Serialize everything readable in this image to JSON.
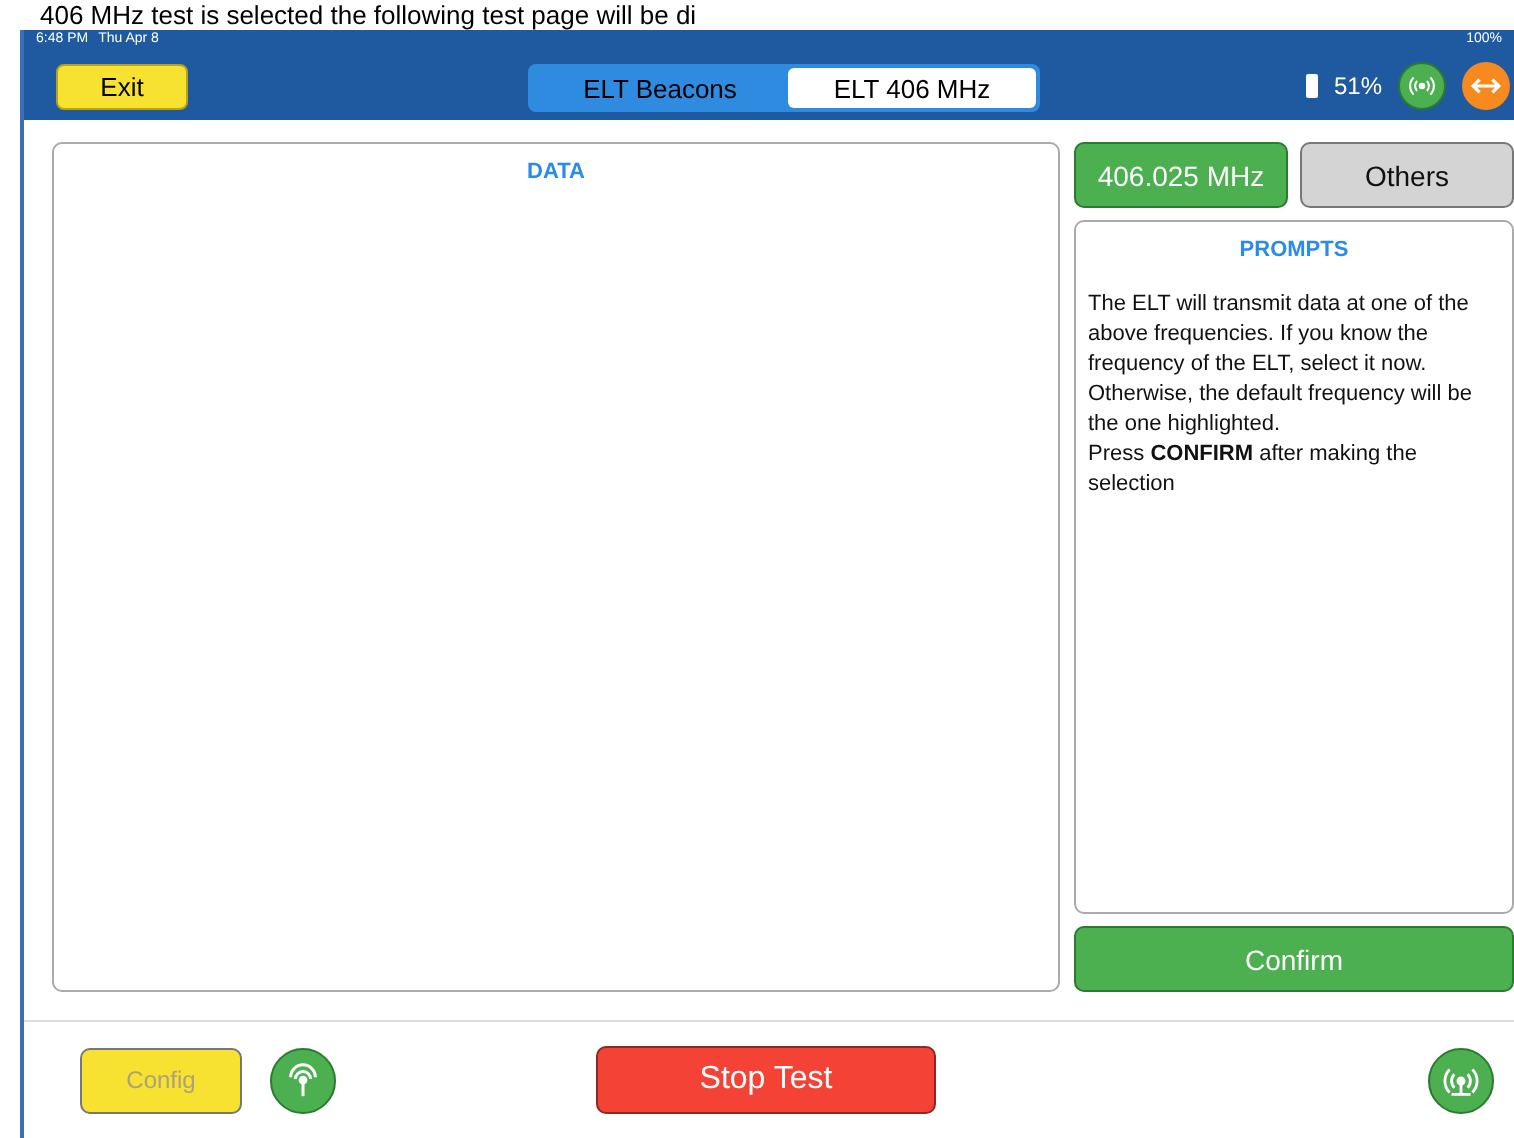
{
  "caption_text": "406 MHz test is selected the following test page will be di",
  "status_bar": {
    "time": "6:48 PM",
    "date": "Thu Apr 8",
    "battery": "100%"
  },
  "nav_bar": {
    "exit_button": "Exit",
    "tabs": [
      {
        "label": "ELT Beacons",
        "selected": false
      },
      {
        "label": "ELT 406 MHz",
        "selected": true
      }
    ],
    "battery_level": "51%"
  },
  "data_panel": {
    "title": "DATA"
  },
  "frequencies": [
    {
      "label": "406.025 MHz",
      "selected": true
    },
    {
      "label": "Others",
      "selected": false
    }
  ],
  "prompts": {
    "title": "PROMPTS",
    "paragraphs": [
      "The ELT will transmit data at one of the above frequencies. If you know the frequency of the ELT, select it now. Otherwise, the default frequency will be the one highlighted.",
      "Press **CONFIRM** after making the selection"
    ]
  },
  "confirm_button": "Confirm",
  "bottom_bar": {
    "config_button": {
      "label": "Config",
      "disabled": true
    },
    "stop_button": "Stop Test"
  }
}
